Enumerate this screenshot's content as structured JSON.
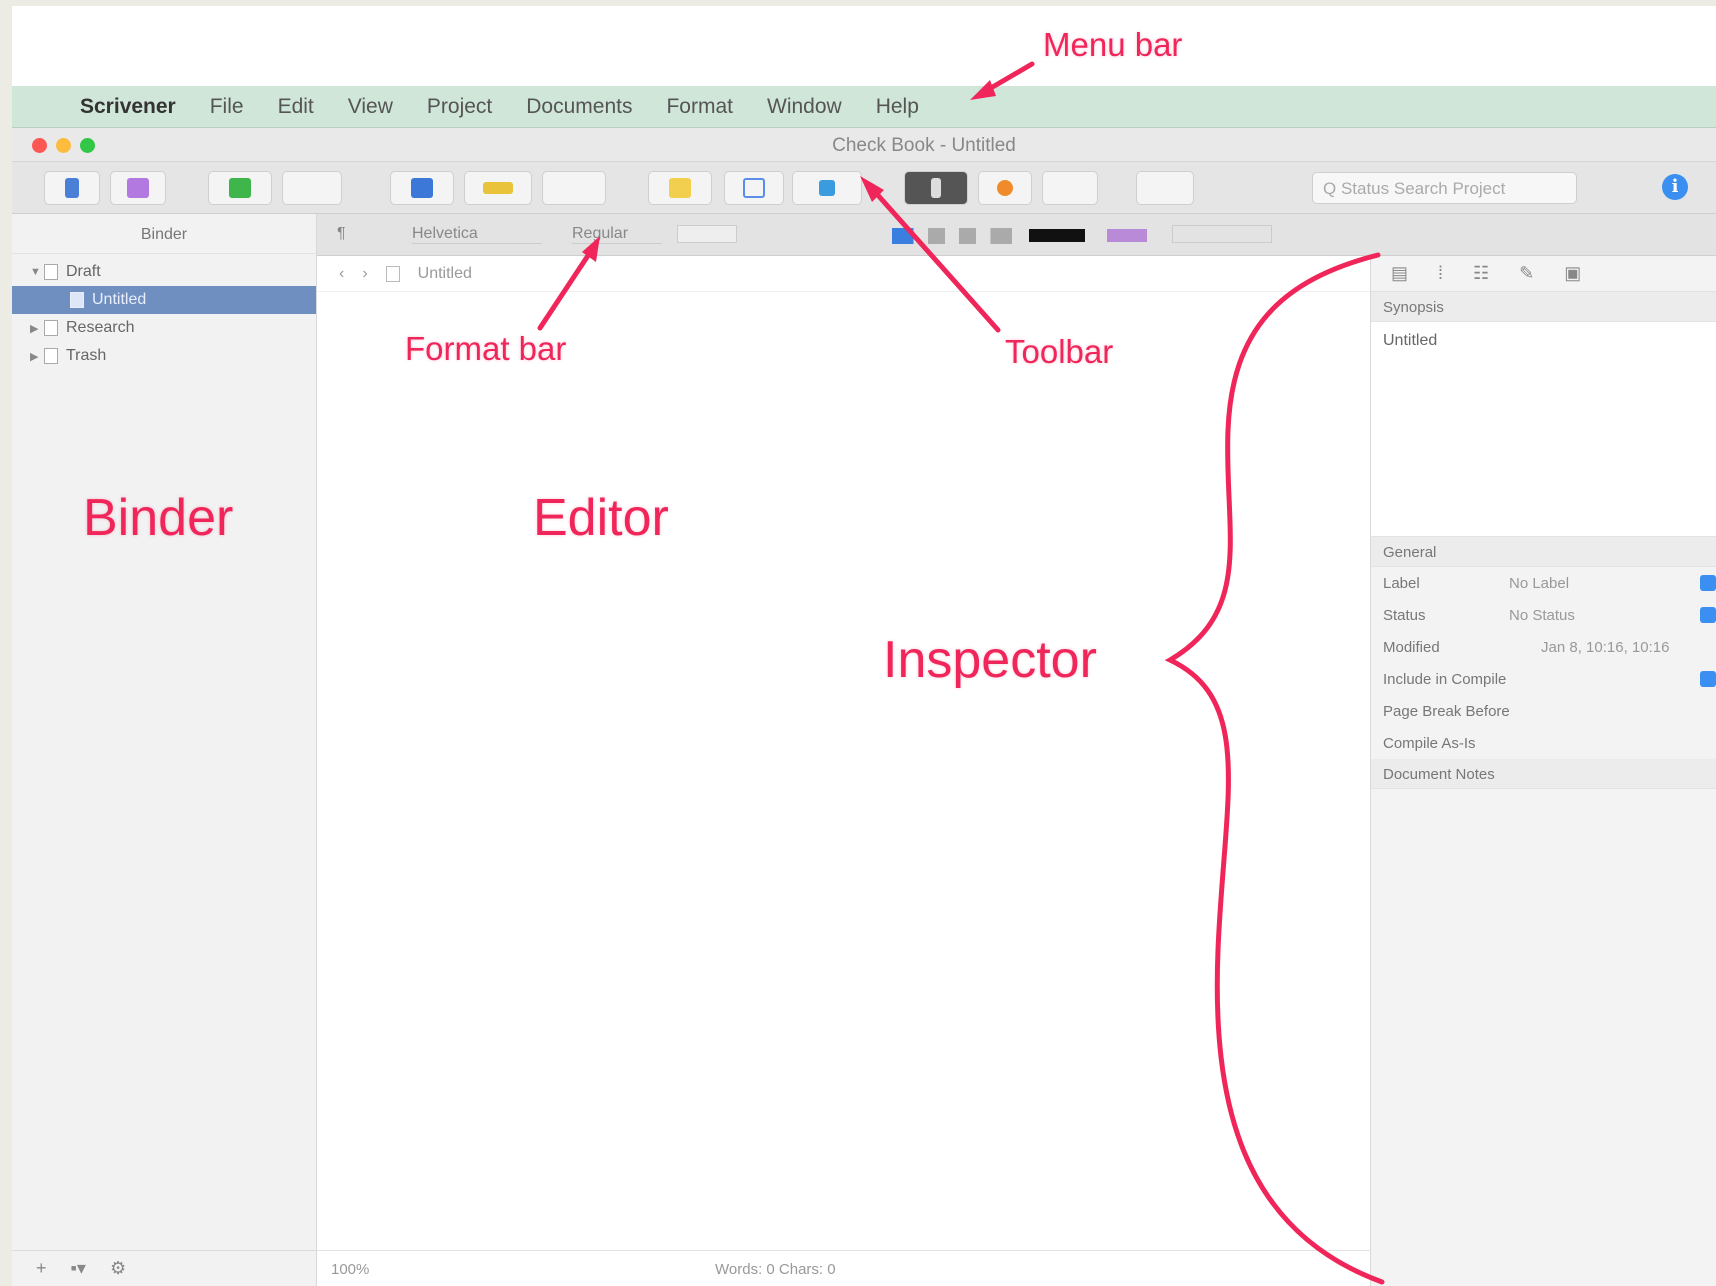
{
  "menubar": {
    "apple": "",
    "app_name": "Scrivener",
    "items": [
      "File",
      "Edit",
      "View",
      "Project",
      "Documents",
      "Format",
      "Window",
      "Help"
    ]
  },
  "window": {
    "title": "Check Book - Untitled",
    "traffic_colors": [
      "#fc5753",
      "#fdbc40",
      "#33c748"
    ]
  },
  "toolbar": {
    "search_placeholder": "Q  Status  Search  Project",
    "inspector_glyph": "i",
    "button_colors": [
      "#4a7fd8",
      "#b27ae0",
      "#3fb64b",
      "#3b78d8",
      "#e9c43b",
      "#f2cf4e",
      "#5a8ee6",
      "#3a9cdf",
      "#444444",
      "#f08a2a"
    ]
  },
  "binder": {
    "header": "Binder",
    "items": [
      {
        "label": "Draft",
        "expanded": true,
        "selected": false,
        "indent": 0
      },
      {
        "label": "Untitled",
        "expanded": false,
        "selected": true,
        "indent": 1
      },
      {
        "label": "Research",
        "expanded": false,
        "selected": false,
        "indent": 0
      },
      {
        "label": "Trash",
        "expanded": false,
        "selected": false,
        "indent": 0
      }
    ],
    "footer": [
      "+",
      "▪▾",
      "⚙"
    ]
  },
  "formatbar": {
    "style": "¶",
    "font_family": "Helvetica",
    "font_style": "Regular",
    "text_color": "#111111",
    "highlight_color": "#b88ad8"
  },
  "editor": {
    "doc_title": "Untitled",
    "zoom": "100%",
    "stats": "Words: 0   Chars: 0"
  },
  "inspector": {
    "synopsis_header": "Synopsis",
    "synopsis_title": "Untitled",
    "general_header": "General",
    "fields": [
      {
        "key": "Label",
        "value": "No Label"
      },
      {
        "key": "Status",
        "value": "No Status"
      },
      {
        "key": "Modified",
        "value": "Jan 8, 10:16, 10:16"
      },
      {
        "key": "Include in Compile",
        "value": ""
      },
      {
        "key": "Page Break Before",
        "value": ""
      },
      {
        "key": "Compile As-Is",
        "value": ""
      },
      {
        "key": "Document Notes",
        "value": ""
      }
    ]
  },
  "annotations": {
    "menu_bar": "Menu bar",
    "format_bar": "Format bar",
    "toolbar": "Toolbar",
    "binder": "Binder",
    "editor": "Editor",
    "inspector": "Inspector",
    "color": "#f0265a"
  }
}
